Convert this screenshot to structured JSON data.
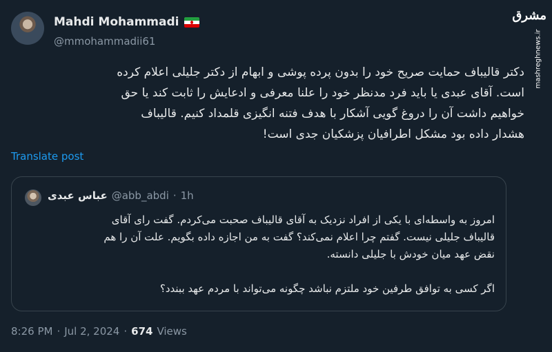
{
  "author": {
    "name": "Mahdi Mohammadi",
    "handle": "@mmohammadii61",
    "flag": "iran-flag"
  },
  "watermark": {
    "logo": "مشرق",
    "url": "mashreghnews.ir"
  },
  "tweet": {
    "text": "دکتر قالیباف حمایت صریح خود را بدون پرده پوشی و ابهام از دکتر جلیلی اعلام کرده\nاست. آقای عبدی یا باید فرد مدنظر خود را علنا معرفی و ادعایش را ثابت کند یا حق\nخواهیم داشت آن را دروغ گویی آشکار با هدف فتنه انگیزی قلمداد کنیم. قالیباف\nهشدار داده بود مشکل اطرافیان پزشکیان جدی است!",
    "translate_label": "Translate post"
  },
  "quote": {
    "name": "عباس عبدی",
    "handle": "@abb_abdi",
    "separator": "·",
    "time": "1h",
    "text": "امروز به واسطه‌ای با یکی از افراد نزدیک به آقای قالیباف صحبت می‌کردم. گفت رای آقای\nقالیباف جلیلی نیست. گفتم چرا اعلام نمی‌کند؟ گفت به من اجازه داده بگویم. علت آن را هم\nنقض عهد میان خودش با جلیلی دانسته.\n\nاگر کسی به توافق طرفین خود ملتزم نباشد چگونه می‌تواند با مردم عهد ببندد؟"
  },
  "footer": {
    "time": "8:26 PM",
    "dot1": "·",
    "date": "Jul 2, 2024",
    "dot2": "·",
    "views_count": "674",
    "views_label": "Views"
  },
  "colors": {
    "background": "#15202b",
    "link": "#1d9bf0",
    "secondary_text": "#8b98a5",
    "border": "#38444d"
  }
}
